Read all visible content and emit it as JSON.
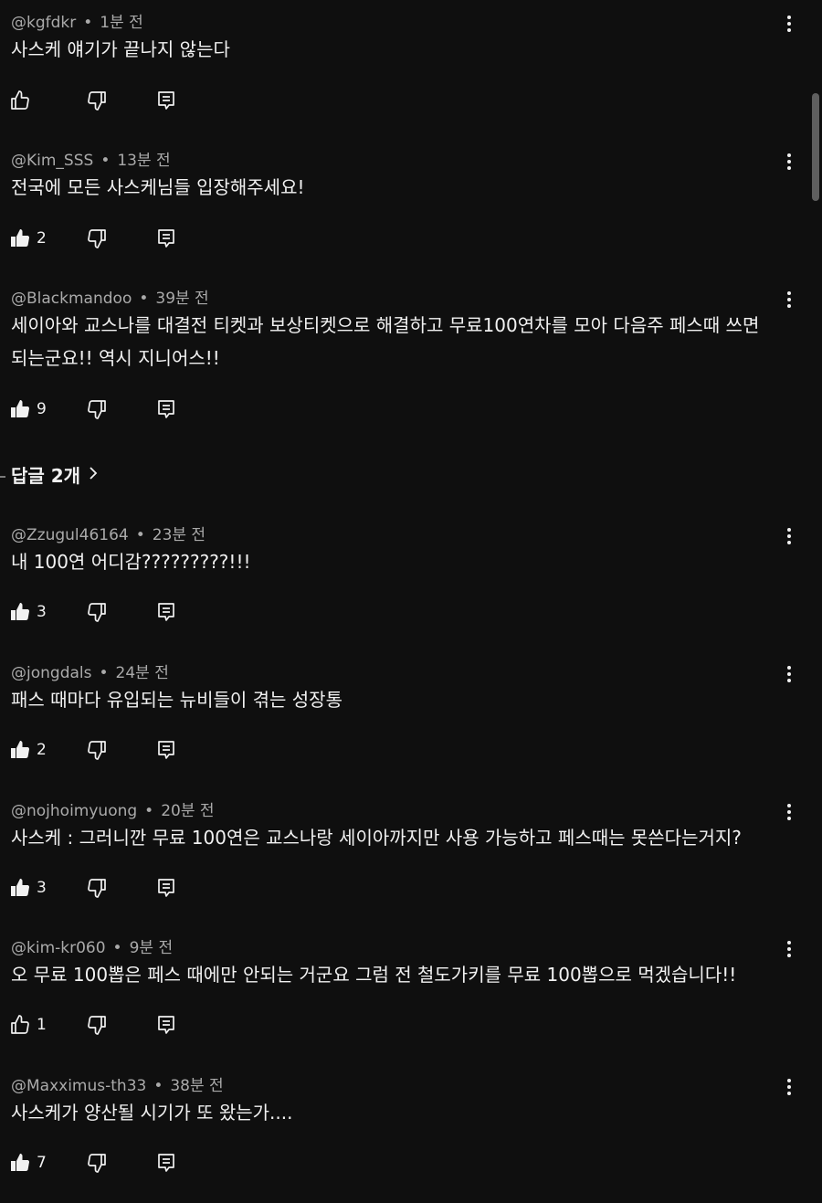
{
  "comments": [
    {
      "author": "@kgfdkr",
      "time": "1분 전",
      "text": "사스케 얘기가 끝나지 않는다",
      "likes": "",
      "liked": false
    },
    {
      "author": "@Kim_SSS",
      "time": "13분 전",
      "text": "전국에 모든 사스케님들 입장해주세요!",
      "likes": "2",
      "liked": true
    },
    {
      "author": "@Blackmandoo",
      "time": "39분 전",
      "text": "세이아와 교스나를 대결전 티켓과 보상티켓으로 해결하고 무료100연차를 모아 다음주 페스때 쓰면 되는군요!! 역시 지니어스!!",
      "likes": "9",
      "liked": true
    },
    {
      "author": "@Zzugul46164",
      "time": "23분 전",
      "text": "내 100연 어디감?????????!!!",
      "likes": "3",
      "liked": true
    },
    {
      "author": "@jongdals",
      "time": "24분 전",
      "text": "패스 때마다 유입되는 뉴비들이 겪는 성장통",
      "likes": "2",
      "liked": true
    },
    {
      "author": "@nojhoimyuong",
      "time": "20분 전",
      "text": "사스케 : 그러니깐 무료 100연은 교스나랑 세이아까지만 사용 가능하고 페스때는 못쓴다는거지?",
      "likes": "3",
      "liked": true
    },
    {
      "author": "@kim-kr060",
      "time": "9분 전",
      "text": "오 무료 100뽑은 페스 때에만 안되는 거군요 그럼 전 철도가키를 무료 100뽑으로 먹겠습니다!!",
      "likes": "1",
      "liked": false
    },
    {
      "author": "@Maxximus-th33",
      "time": "38분 전",
      "text": "사스케가 양산될 시기가 또 왔는가....",
      "likes": "7",
      "liked": true
    }
  ],
  "replies_link": "답글 2개",
  "icons": {
    "like": "thumbs-up-icon",
    "dislike": "thumbs-down-icon",
    "reply": "reply-icon",
    "menu": "more-vert-icon",
    "chevron": "chevron-right-icon"
  },
  "colors": {
    "background": "#0f0f0f",
    "text": "#f1f1f1",
    "meta": "#aaaaaa"
  }
}
